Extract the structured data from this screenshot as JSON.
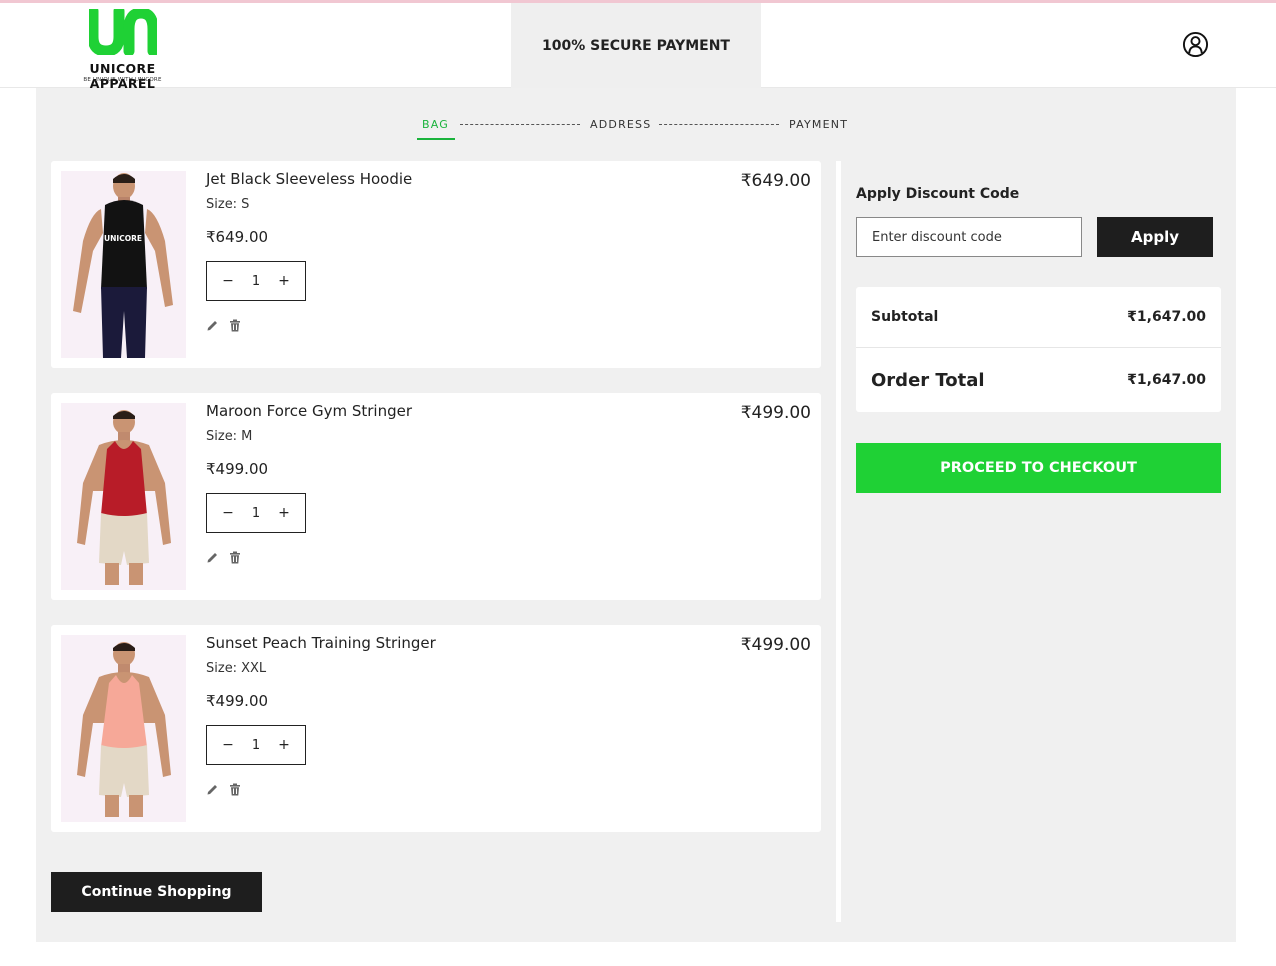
{
  "brand": {
    "name": "UNICORE APPAREL",
    "tagline": "BE UNIQUE WITH UNICORE",
    "mark_color": "#1fd135"
  },
  "header": {
    "secure_label": "100% SECURE PAYMENT",
    "account_icon": "user-circle-icon"
  },
  "steps": [
    {
      "label": "BAG",
      "active": true
    },
    {
      "label": "ADDRESS",
      "active": false
    },
    {
      "label": "PAYMENT",
      "active": false
    }
  ],
  "cart": {
    "size_label": "Size:",
    "qty_minus": "−",
    "qty_plus": "+",
    "edit_icon": "pencil-icon",
    "delete_icon": "trash-icon",
    "items": [
      {
        "name": "Jet Black Sleeveless Hoodie",
        "size": "S",
        "unit_price": "₹649.00",
        "quantity": "1",
        "total": "₹649.00",
        "image_colors": {
          "shirt": "#121212",
          "bottom": "#1b1a3a"
        },
        "print_text": "UNICORE"
      },
      {
        "name": "Maroon Force Gym Stringer",
        "size": "M",
        "unit_price": "₹499.00",
        "quantity": "1",
        "total": "₹499.00",
        "image_colors": {
          "shirt": "#b81c28",
          "bottom": "#e3d8c6"
        }
      },
      {
        "name": "Sunset Peach Training Stringer",
        "size": "XXL",
        "unit_price": "₹499.00",
        "quantity": "1",
        "total": "₹499.00",
        "image_colors": {
          "shirt": "#f6a898",
          "bottom": "#e3d8c6"
        }
      }
    ],
    "continue_label": "Continue Shopping"
  },
  "discount": {
    "title": "Apply Discount Code",
    "placeholder": "Enter discount code",
    "apply_label": "Apply"
  },
  "summary": {
    "subtotal_label": "Subtotal",
    "subtotal_value": "₹1,647.00",
    "total_label": "Order Total",
    "total_value": "₹1,647.00"
  },
  "checkout_label": "PROCEED TO CHECKOUT",
  "colors": {
    "accent": "#1fd135",
    "dark_button": "#1e1e1e",
    "page_bg": "#f0f0f0"
  }
}
